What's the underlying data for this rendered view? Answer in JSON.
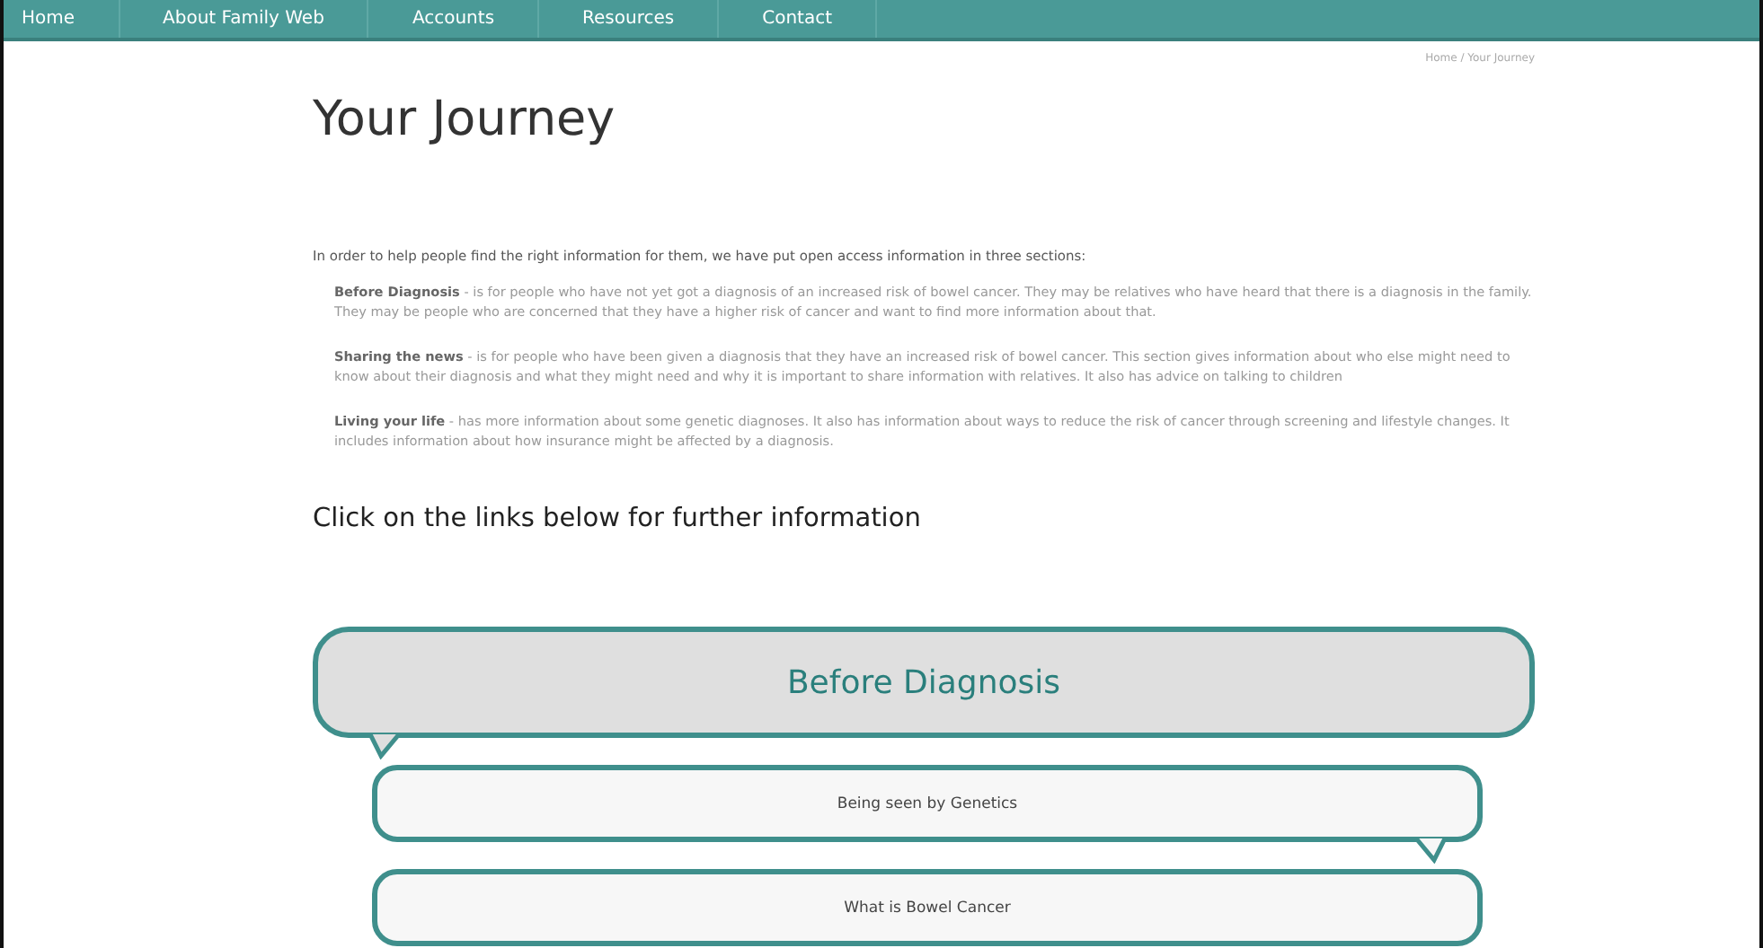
{
  "nav": [
    {
      "label": "Home"
    },
    {
      "label": "About Family Web"
    },
    {
      "label": "Accounts"
    },
    {
      "label": "Resources"
    },
    {
      "label": "Contact"
    }
  ],
  "breadcrumb": "Home / Your Journey",
  "title": "Your Journey",
  "intro": "In order to help people find the right information for them, we have put open access information in three sections:",
  "bullets": [
    {
      "text": "**Before Diagnosis** - is for people who have not yet got a diagnosis of an increased risk of bowel cancer. They may be relatives who have heard that there is a diagnosis in the family. They may be people who are concerned that they have a higher risk of cancer and want to find more information about that."
    },
    {
      "text": "**Sharing the news** - is for people who have been given a diagnosis that they have an increased risk of bowel cancer. This section gives information about who else might need to know about their diagnosis and what they might need and why it is important to share information with relatives. It also has advice on talking to children"
    },
    {
      "text": "**Living your life** - has more information about some genetic diagnoses. It also has information about ways to reduce the risk of cancer through screening and lifestyle changes. It includes information about how insurance might be affected by a diagnosis."
    }
  ],
  "links_heading": "Click on the links below for further information",
  "journey": [
    {
      "kind": "section",
      "label": "Before Diagnosis",
      "tail_left": true,
      "tail_right": false
    },
    {
      "kind": "link",
      "label": "Being seen by Genetics",
      "tail_left": false,
      "tail_right": true
    },
    {
      "kind": "link",
      "label": "What is Bowel Cancer",
      "tail_left": false,
      "tail_right": false
    }
  ]
}
